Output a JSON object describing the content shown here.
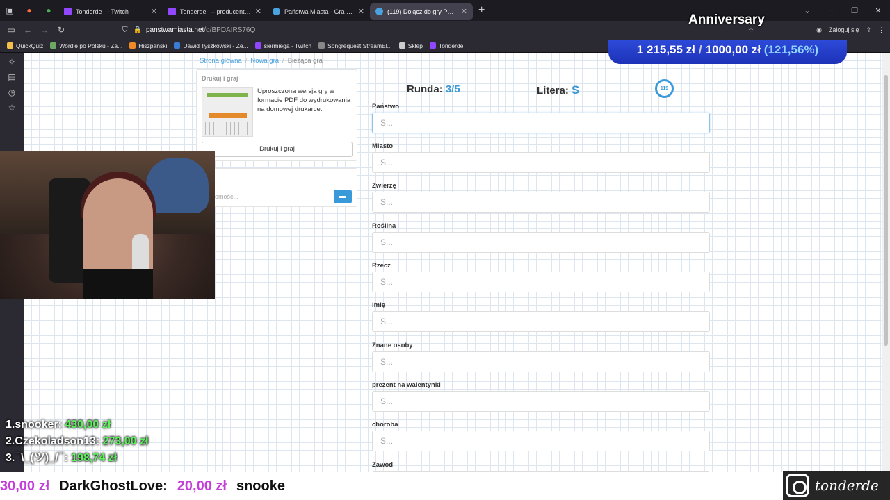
{
  "tabs": [
    {
      "title": "Tonderde_ - Twitch",
      "color": "#9146ff"
    },
    {
      "title": "Tonderde_ – producent wideo",
      "color": "#9146ff"
    },
    {
      "title": "Państwa Miasta - Gra online",
      "color": "#4aa3df"
    },
    {
      "title": "(119) Dołącz do gry Państwa M",
      "color": "#4aa3df"
    }
  ],
  "url": {
    "host": "panstwamiasta.net",
    "path": "/g/BPDAIRS76Q"
  },
  "login_label": "Zaloguj się",
  "bookmarks": [
    {
      "label": "QuickQuiz",
      "color": "#f5c04a"
    },
    {
      "label": "Wordle po Polsku - Za...",
      "color": "#6aaa64"
    },
    {
      "label": "Hiszpański",
      "color": "#f08a24"
    },
    {
      "label": "Dawid Tyszkowski - Ze...",
      "color": "#3a7bd5"
    },
    {
      "label": "siermiega - Twitch",
      "color": "#9146ff"
    },
    {
      "label": "Songrequest StreamEl...",
      "color": "#888888"
    },
    {
      "label": "Sklep",
      "color": "#cccccc"
    },
    {
      "label": "Tonderde_",
      "color": "#9146ff"
    }
  ],
  "breadcrumb": {
    "home": "Strona główna",
    "new": "Nowa gra",
    "current": "Bieżąca gra"
  },
  "print_panel": {
    "header": "Drukuj i graj",
    "description": "Uproszczona wersja gry w formacie PDF do wydrukowania na domowej drukarce.",
    "button": "Drukuj i graj"
  },
  "chat": {
    "placeholder": "adomość..."
  },
  "game": {
    "round_label": "Runda:",
    "round_value": "3/5",
    "letter_label": "Litera:",
    "letter_value": "S",
    "timer": "119"
  },
  "fields": [
    {
      "label": "Państwo",
      "placeholder": "S..."
    },
    {
      "label": "Miasto",
      "placeholder": "S..."
    },
    {
      "label": "Zwierzę",
      "placeholder": "S..."
    },
    {
      "label": "Roślina",
      "placeholder": "S..."
    },
    {
      "label": "Rzecz",
      "placeholder": "S..."
    },
    {
      "label": "Imię",
      "placeholder": "S..."
    },
    {
      "label": "Znane osoby",
      "placeholder": "S..."
    },
    {
      "label": "prezent na walentynki",
      "placeholder": "S..."
    },
    {
      "label": "choroba",
      "placeholder": "S..."
    },
    {
      "label": "Zawód",
      "placeholder": ""
    }
  ],
  "overlay": {
    "anniversary": "Anniversary",
    "goal_current": "1 215,55 zł",
    "goal_target": "1000,00 zł",
    "goal_percent": "(121,56%)",
    "top": [
      {
        "rank": "1.",
        "name": "snooker:",
        "amount": "430,00 zł"
      },
      {
        "rank": "2.",
        "name": "Czekoladson13:",
        "amount": "273,00 zł"
      },
      {
        "rank": "3.",
        "name": "¯\\_(ツ)_/¯:",
        "amount": "198,74 zł"
      }
    ],
    "ticker": {
      "lead_amount": "30,00 zł",
      "name": "DarkGhostLove:",
      "amount": "20,00 zł",
      "next": "snooke"
    },
    "instagram": "tonderde"
  }
}
